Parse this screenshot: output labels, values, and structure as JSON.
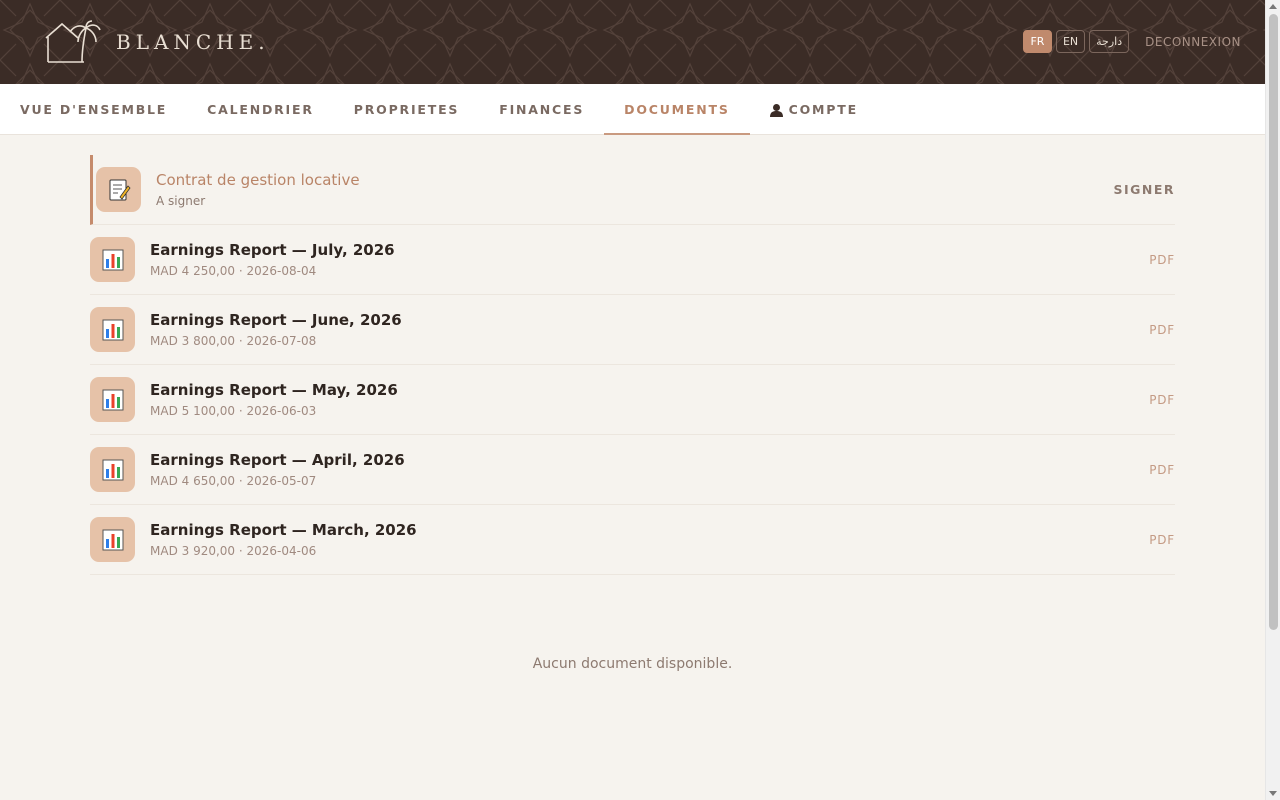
{
  "header": {
    "brand": "BLANCHE.",
    "languages": [
      {
        "label": "FR",
        "active": true
      },
      {
        "label": "EN",
        "active": false
      },
      {
        "label": "دارجة",
        "active": false
      }
    ],
    "logout": "DECONNEXION"
  },
  "nav": {
    "items": [
      {
        "label": "VUE D'ENSEMBLE"
      },
      {
        "label": "CALENDRIER"
      },
      {
        "label": "PROPRIETES"
      },
      {
        "label": "FINANCES"
      },
      {
        "label": "DOCUMENTS"
      },
      {
        "label": "COMPTE",
        "icon": "user-icon"
      }
    ],
    "active": "DOCUMENTS"
  },
  "documents": [
    {
      "title": "Contrat de gestion locative",
      "subtitle": "A signer",
      "action": "SIGNER",
      "icon": "memo-icon",
      "pending": true
    },
    {
      "title": "Earnings Report — July, 2026",
      "subtitle": "MAD 4 250,00 · 2026-08-04",
      "action": "PDF",
      "icon": "bar-chart-icon"
    },
    {
      "title": "Earnings Report — June, 2026",
      "subtitle": "MAD 3 800,00 · 2026-07-08",
      "action": "PDF",
      "icon": "bar-chart-icon"
    },
    {
      "title": "Earnings Report — May, 2026",
      "subtitle": "MAD 5 100,00 · 2026-06-03",
      "action": "PDF",
      "icon": "bar-chart-icon"
    },
    {
      "title": "Earnings Report — April, 2026",
      "subtitle": "MAD 4 650,00 · 2026-05-07",
      "action": "PDF",
      "icon": "bar-chart-icon"
    },
    {
      "title": "Earnings Report — March, 2026",
      "subtitle": "MAD 3 920,00 · 2026-04-06",
      "action": "PDF",
      "icon": "bar-chart-icon"
    }
  ],
  "empty_message": "Aucun document disponible.",
  "colors": {
    "header_bg": "#3b2c26",
    "accent": "#c08a6d",
    "page_bg": "#f6f3ee"
  }
}
